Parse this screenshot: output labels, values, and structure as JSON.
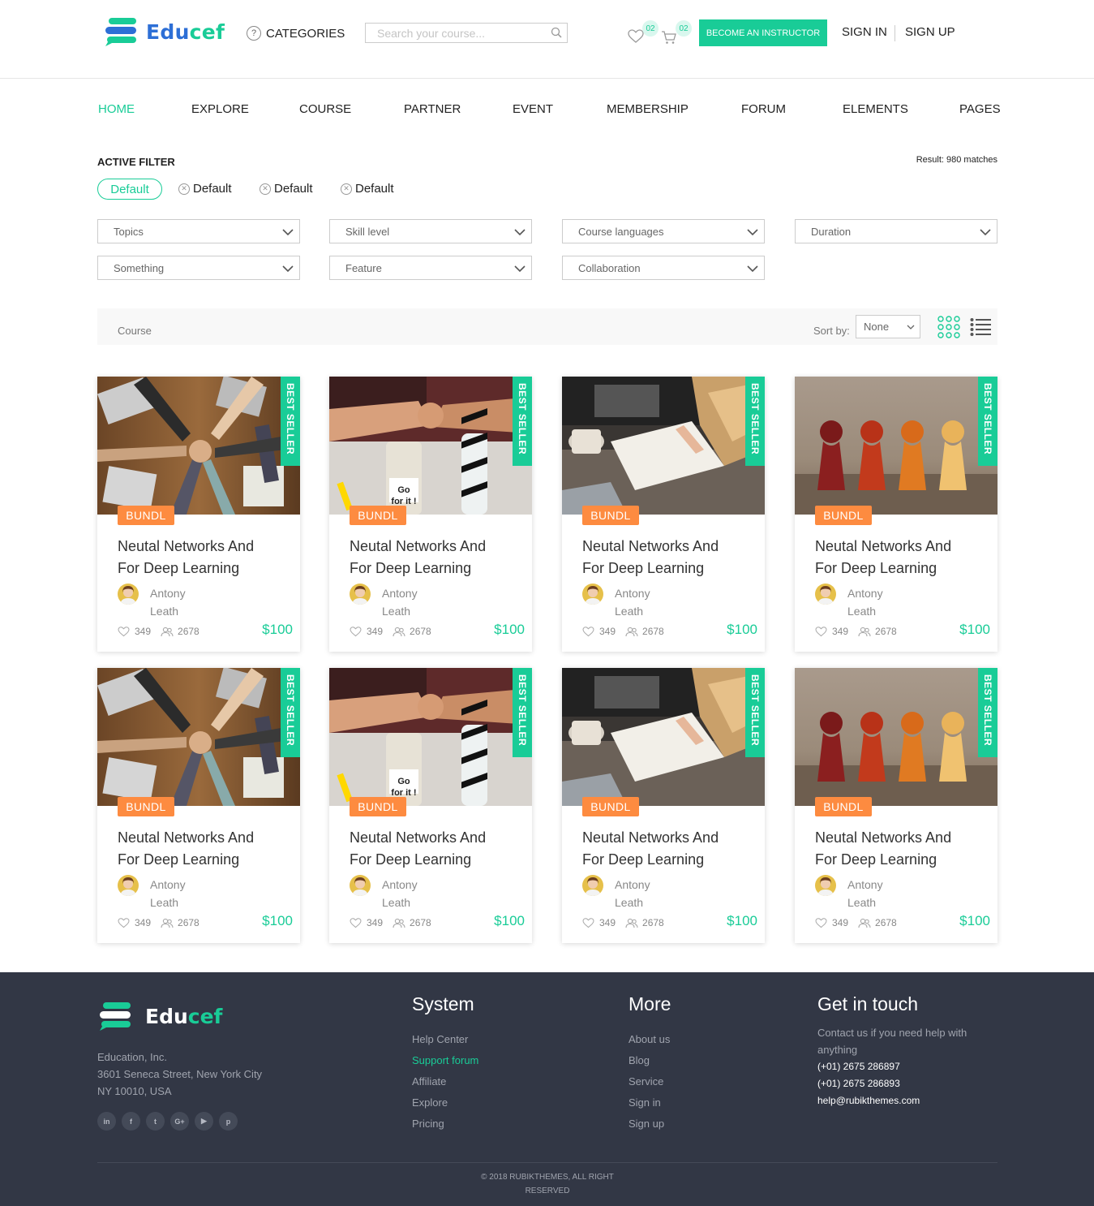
{
  "brand": {
    "name_part1": "Edu",
    "name_part2": "cef"
  },
  "header": {
    "categories_label": "CATEGORIES",
    "search_placeholder": "Search your course...",
    "wishlist_count": "02",
    "cart_count": "02",
    "become_instructor": "BECOME AN INSTRUCTOR",
    "sign_in": "SIGN IN",
    "sign_up": "SIGN UP"
  },
  "nav": {
    "items": [
      "HOME",
      "EXPLORE",
      "COURSE",
      "PARTNER",
      "EVENT",
      "MEMBERSHIP",
      "FORUM",
      "ELEMENTS",
      "PAGES"
    ],
    "active": "HOME"
  },
  "filter": {
    "title": "ACTIVE FILTER",
    "result": "Result: 980 matches",
    "chips": [
      "Default",
      "Default",
      "Default",
      "Default"
    ],
    "selects": [
      "Topics",
      "Skill level",
      "Course languages",
      "Duration",
      "Something",
      "Feature",
      "Collaboration"
    ]
  },
  "toolbar": {
    "label": "Course",
    "sort_label": "Sort by:",
    "sort_value": "None"
  },
  "cards": [
    {
      "ribbon": "BEST SELLER",
      "badge": "BUNDL",
      "title": "Neutal Networks And For Deep Learning",
      "author": "Antony Leath",
      "likes": "349",
      "students": "2678",
      "price": "$100",
      "image": "team-hands"
    },
    {
      "ribbon": "BEST SELLER",
      "badge": "BUNDL",
      "title": "Neutal Networks And For Deep Learning",
      "author": "Antony Leath",
      "likes": "349",
      "students": "2678",
      "price": "$100",
      "image": "fist-bump"
    },
    {
      "ribbon": "BEST SELLER",
      "badge": "BUNDL",
      "title": "Neutal Networks And For Deep Learning",
      "author": "Antony Leath",
      "likes": "349",
      "students": "2678",
      "price": "$100",
      "image": "notebook-study"
    },
    {
      "ribbon": "BEST SELLER",
      "badge": "BUNDL",
      "title": "Neutal Networks And For Deep Learning",
      "author": "Antony Leath",
      "likes": "349",
      "students": "2678",
      "price": "$100",
      "image": "pawns"
    },
    {
      "ribbon": "BEST SELLER",
      "badge": "BUNDL",
      "title": "Neutal Networks And For Deep Learning",
      "author": "Antony Leath",
      "likes": "349",
      "students": "2678",
      "price": "$100",
      "image": "team-hands"
    },
    {
      "ribbon": "BEST SELLER",
      "badge": "BUNDL",
      "title": "Neutal Networks And For Deep Learning",
      "author": "Antony Leath",
      "likes": "349",
      "students": "2678",
      "price": "$100",
      "image": "fist-bump"
    },
    {
      "ribbon": "BEST SELLER",
      "badge": "BUNDL",
      "title": "Neutal Networks And For Deep Learning",
      "author": "Antony Leath",
      "likes": "349",
      "students": "2678",
      "price": "$100",
      "image": "notebook-study"
    },
    {
      "ribbon": "BEST SELLER",
      "badge": "BUNDL",
      "title": "Neutal Networks And For Deep Learning",
      "author": "Antony Leath",
      "likes": "349",
      "students": "2678",
      "price": "$100",
      "image": "pawns"
    }
  ],
  "footer": {
    "address": [
      "Education, Inc.",
      "3601 Seneca Street, New York City",
      "NY 10010, USA"
    ],
    "socials": [
      "in",
      "f",
      "t",
      "G+",
      "▶",
      "p"
    ],
    "system": {
      "title": "System",
      "links": [
        "Help Center",
        "Support forum",
        "Affiliate",
        "Explore",
        "Pricing"
      ],
      "highlight": "Support forum"
    },
    "more": {
      "title": "More",
      "links": [
        "About us",
        "Blog",
        "Service",
        "Sign in",
        "Sign up"
      ]
    },
    "contact": {
      "title": "Get in touch",
      "text": "Contact us if you need help with anything",
      "phone1": "(+01) 2675 286897",
      "phone2": "(+01) 2675 286893",
      "email": "help@rubikthemes.com"
    },
    "copyright": "© 2018 RUBIKTHEMES, ALL RIGHT RESERVED"
  },
  "colors": {
    "accent": "#19cc97",
    "brand_blue": "#2d6fd6",
    "badge_orange": "#fd8b40",
    "footer_bg": "#323745"
  }
}
